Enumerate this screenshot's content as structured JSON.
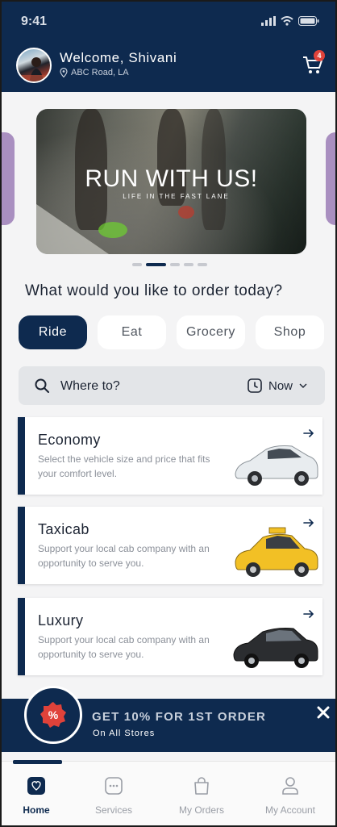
{
  "status": {
    "time": "9:41"
  },
  "user": {
    "greeting": "Welcome, Shivani",
    "location": "ABC Road, LA"
  },
  "cart": {
    "count": "4"
  },
  "banner": {
    "title": "RUN WITH US!",
    "subtitle": "LIFE IN THE FAST LANE",
    "active_slide": 2,
    "slide_count": 5
  },
  "question": "What would you like to order today?",
  "categories": [
    {
      "label": "Ride",
      "active": true
    },
    {
      "label": "Eat",
      "active": false
    },
    {
      "label": "Grocery",
      "active": false
    },
    {
      "label": "Shop",
      "active": false
    }
  ],
  "search": {
    "placeholder": "Where to?",
    "time_option": "Now"
  },
  "rides": [
    {
      "title": "Economy",
      "description": "Select the vehicle size and price that fits your comfort level.",
      "car_color": "#e8ecef"
    },
    {
      "title": "Taxicab",
      "description": "Support your local cab company with an opportunity to serve you.",
      "car_color": "#f2c025"
    },
    {
      "title": "Luxury",
      "description": "Support your local cab company with an opportunity to serve you.",
      "car_color": "#2b2d30"
    }
  ],
  "promo": {
    "badge": "%",
    "title": "GET 10% FOR 1ST ORDER",
    "subtitle": "On All Stores"
  },
  "nav": [
    {
      "label": "Home",
      "icon": "home-icon",
      "active": true
    },
    {
      "label": "Services",
      "icon": "services-icon",
      "active": false
    },
    {
      "label": "My Orders",
      "icon": "shopping-bag-icon",
      "active": false
    },
    {
      "label": "My Account",
      "icon": "account-icon",
      "active": false
    }
  ],
  "colors": {
    "primary": "#0e2a4f",
    "accent": "#e0423a",
    "background": "#f4f4f5"
  }
}
